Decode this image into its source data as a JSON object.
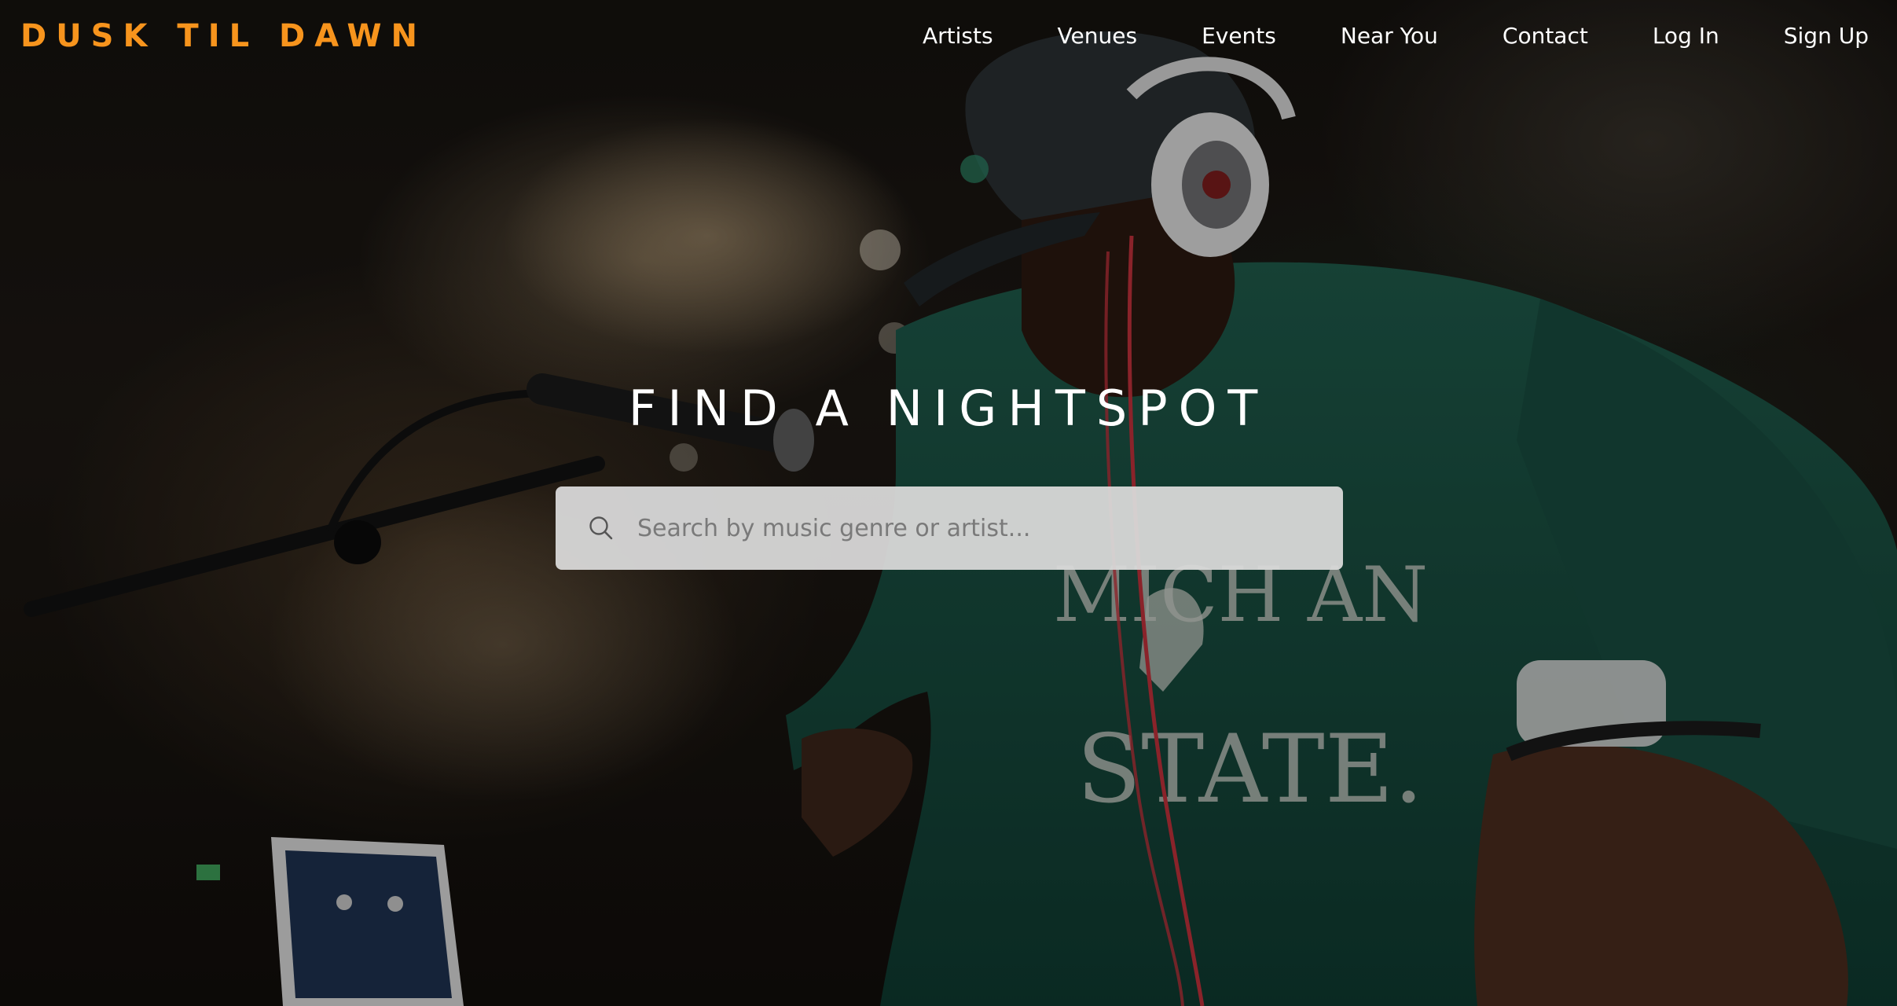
{
  "brand": {
    "logo_text": "DUSK TIL DAWN",
    "accent_color": "#f7941d"
  },
  "nav": {
    "items": [
      {
        "label": "Artists"
      },
      {
        "label": "Venues"
      },
      {
        "label": "Events"
      },
      {
        "label": "Near You"
      },
      {
        "label": "Contact"
      },
      {
        "label": "Log In"
      },
      {
        "label": "Sign Up"
      }
    ]
  },
  "hero": {
    "title": "FIND A NIGHTSPOT",
    "search": {
      "placeholder": "Search by music genre or artist...",
      "value": "",
      "icon": "search-icon"
    }
  }
}
